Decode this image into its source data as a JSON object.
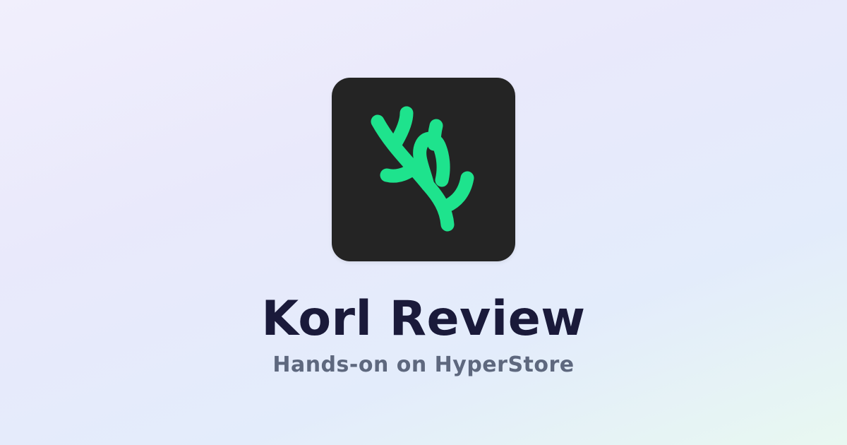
{
  "app": {
    "logo_icon": "branching-coral-logo-icon",
    "title": "Korl Review",
    "subtitle": "Hands-on on HyperStore"
  },
  "colors": {
    "tile_background": "#242424",
    "logo_accent": "#1ee38d",
    "title_text": "#1a1a3a",
    "subtitle_text": "#5e687e"
  }
}
